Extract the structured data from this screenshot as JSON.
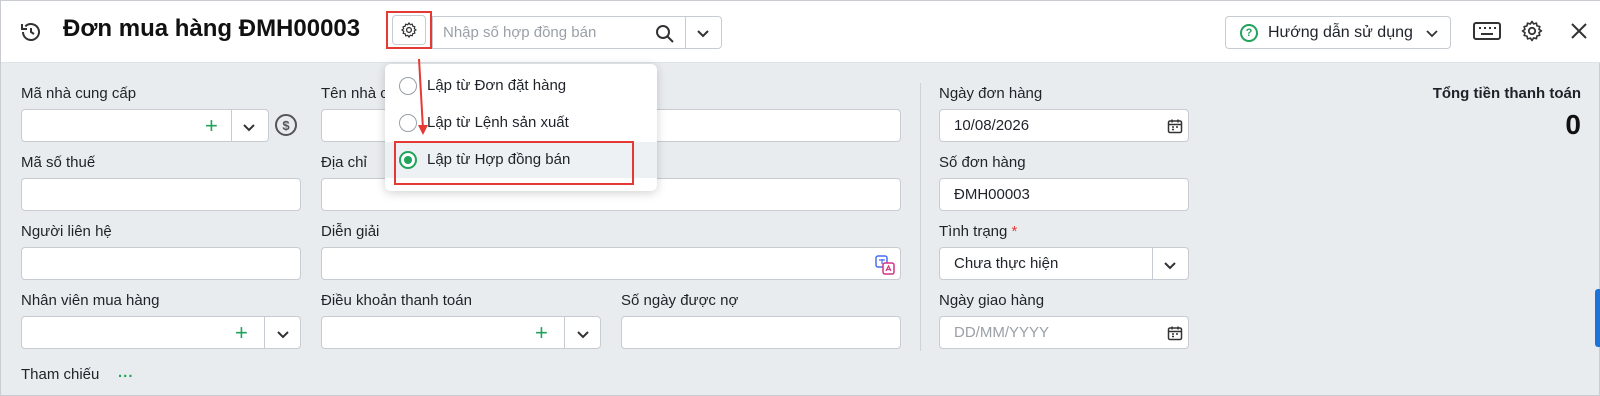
{
  "header": {
    "title": "Đơn mua hàng ĐMH00003",
    "search_placeholder": "Nhập số hợp đồng bán",
    "help_label": "Hướng dẫn sử dụng"
  },
  "menu": {
    "items": [
      {
        "label": "Lập từ Đơn đặt hàng",
        "selected": false
      },
      {
        "label": "Lập từ Lệnh sản xuất",
        "selected": false
      },
      {
        "label": "Lập từ Hợp đồng bán",
        "selected": true
      }
    ]
  },
  "form": {
    "supplier_code_label": "Mã nhà cung cấp",
    "supplier_name_label": "Tên nhà cung cấp",
    "tax_code_label": "Mã số thuế",
    "address_label": "Địa chỉ",
    "contact_label": "Người liên hệ",
    "description_label": "Diễn giải",
    "purchaser_label": "Nhân viên mua hàng",
    "payment_terms_label": "Điều khoản thanh toán",
    "credit_days_label": "Số ngày được nợ",
    "order_date_label": "Ngày đơn hàng",
    "order_date_value": "10/08/2026",
    "order_no_label": "Số đơn hàng",
    "order_no_value": "ĐMH00003",
    "status_label": "Tình trạng",
    "status_required": "*",
    "status_value": "Chưa thực hiện",
    "delivery_date_label": "Ngày giao hàng",
    "delivery_date_placeholder": "DD/MM/YYYY",
    "total_label": "Tổng tiền thanh toán",
    "total_value": "0",
    "reference_label": "Tham chiếu",
    "reference_more": "..."
  },
  "colors": {
    "accent_green": "#20a35a",
    "annotation_red": "#e53935",
    "scroll_blue": "#1e73d8"
  }
}
